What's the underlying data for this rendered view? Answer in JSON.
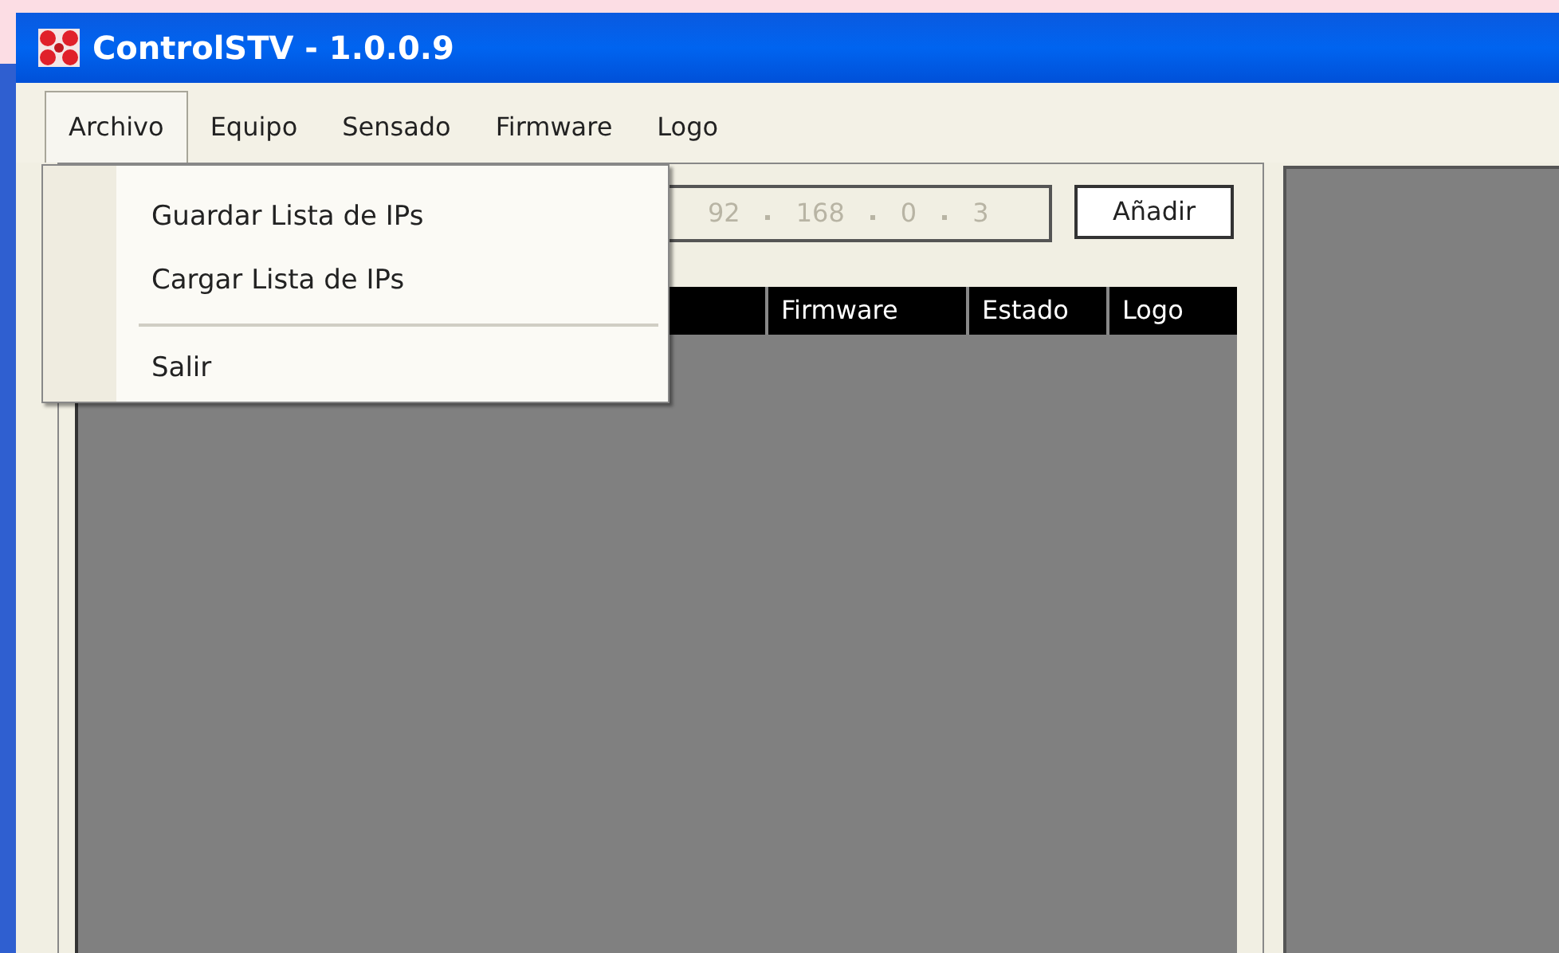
{
  "window": {
    "title": "ControlSTV - 1.0.0.9"
  },
  "menu_bar": [
    {
      "label": "Archivo",
      "selected": true
    },
    {
      "label": "Equipo",
      "selected": false
    },
    {
      "label": "Sensado",
      "selected": false
    },
    {
      "label": "Firmware",
      "selected": false
    },
    {
      "label": "Logo",
      "selected": false
    }
  ],
  "open_menu": {
    "items": [
      {
        "kind": "item",
        "label": "Guardar Lista de IPs"
      },
      {
        "kind": "item",
        "label": "Cargar Lista de IPs"
      },
      {
        "kind": "separator"
      },
      {
        "kind": "item",
        "label": "Salir"
      }
    ]
  },
  "ip_field": {
    "octets": [
      "92",
      "168",
      "0",
      "3"
    ]
  },
  "add_button": "Añadir",
  "table": {
    "columns": [
      "Firmware",
      "Estado",
      "Logo"
    ]
  }
}
